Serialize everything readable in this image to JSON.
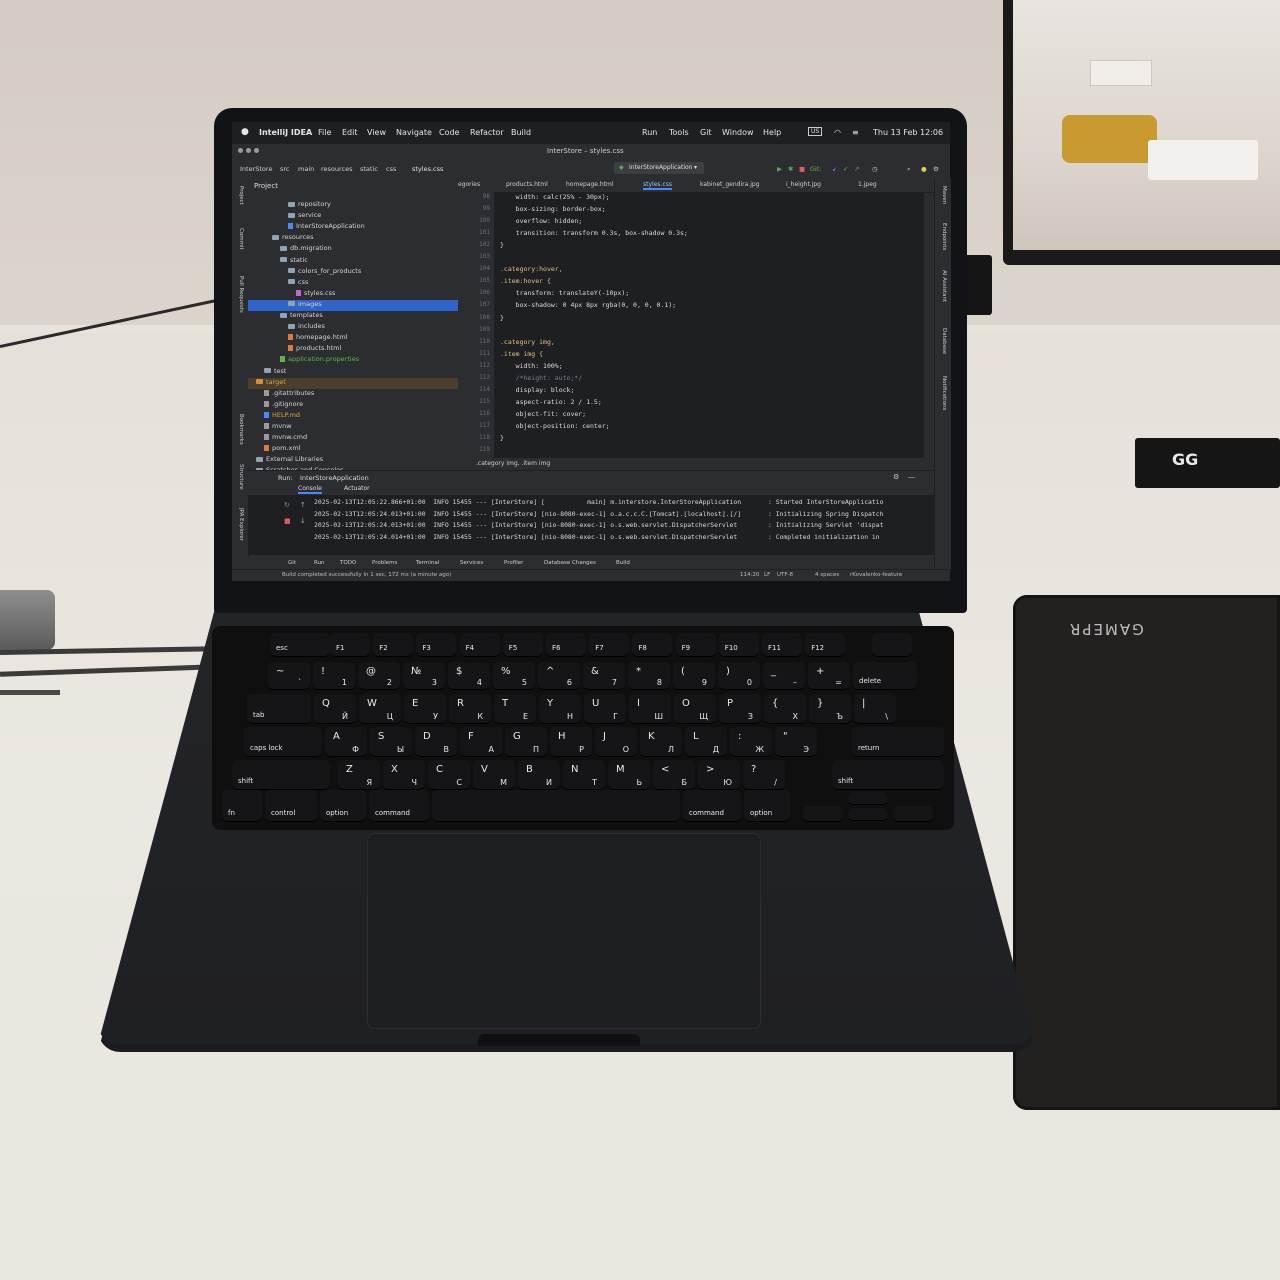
{
  "menubar": {
    "app": "IntelliJ IDEA",
    "items": [
      "File",
      "Edit",
      "View",
      "Navigate",
      "Code",
      "Refactor",
      "Build",
      "Run",
      "Tools",
      "Git",
      "Window",
      "Help"
    ],
    "input_source": "US",
    "clock": "Thu 13 Feb  12:06"
  },
  "window": {
    "title": "InterStore – styles.css"
  },
  "breadcrumbs": [
    "InterStore",
    "src",
    "main",
    "resources",
    "static",
    "css",
    "styles.css"
  ],
  "run_config": "InterStoreApplication",
  "git_label": "Git:",
  "project": {
    "header": "Project",
    "tree": [
      {
        "label": "repository",
        "depth": 4,
        "type": "folder"
      },
      {
        "label": "service",
        "depth": 4,
        "type": "folder"
      },
      {
        "label": "InterStoreApplication",
        "depth": 4,
        "type": "class"
      },
      {
        "label": "resources",
        "depth": 2,
        "type": "folder"
      },
      {
        "label": "db.migration",
        "depth": 3,
        "type": "folder"
      },
      {
        "label": "static",
        "depth": 3,
        "type": "folder"
      },
      {
        "label": "colors_for_products",
        "depth": 4,
        "type": "folder"
      },
      {
        "label": "css",
        "depth": 4,
        "type": "folder"
      },
      {
        "label": "styles.css",
        "depth": 5,
        "type": "css"
      },
      {
        "label": "images",
        "depth": 4,
        "type": "folder",
        "selected": true
      },
      {
        "label": "templates",
        "depth": 3,
        "type": "folder"
      },
      {
        "label": "includes",
        "depth": 4,
        "type": "folder"
      },
      {
        "label": "homepage.html",
        "depth": 4,
        "type": "html"
      },
      {
        "label": "products.html",
        "depth": 4,
        "type": "html"
      },
      {
        "label": "application.properties",
        "depth": 3,
        "type": "props"
      },
      {
        "label": "test",
        "depth": 1,
        "type": "folder"
      },
      {
        "label": "target",
        "depth": 0,
        "type": "folder-orange",
        "highlighted": true
      },
      {
        "label": ".gitattributes",
        "depth": 1,
        "type": "file"
      },
      {
        "label": ".gitignore",
        "depth": 1,
        "type": "file"
      },
      {
        "label": "HELP.md",
        "depth": 1,
        "type": "md"
      },
      {
        "label": "mvnw",
        "depth": 1,
        "type": "file"
      },
      {
        "label": "mvnw.cmd",
        "depth": 1,
        "type": "file"
      },
      {
        "label": "pom.xml",
        "depth": 1,
        "type": "xml"
      },
      {
        "label": "External Libraries",
        "depth": 0,
        "type": "folder"
      },
      {
        "label": "Scratches and Consoles",
        "depth": 0,
        "type": "folder"
      }
    ]
  },
  "left_tools": [
    "Project",
    "Commit",
    "Pull Requests",
    "Bookmarks",
    "Structure",
    "JPA Explorer"
  ],
  "right_tools": [
    "Maven",
    "Endpoints",
    "AI Assistant",
    "Database",
    "Notifications"
  ],
  "tabs": [
    {
      "label": "egories",
      "active": false
    },
    {
      "label": "products.html",
      "active": false
    },
    {
      "label": "homepage.html",
      "active": false
    },
    {
      "label": "styles.css",
      "active": true
    },
    {
      "label": "kabinet_gendira.jpg",
      "active": false
    },
    {
      "label": "i_height.jpg",
      "active": false
    },
    {
      "label": "1.jpeg",
      "active": false
    }
  ],
  "editor": {
    "lines": [
      {
        "n": "98",
        "text": "    width: calc(25% - 30px);"
      },
      {
        "n": "99",
        "text": "    box-sizing: border-box;"
      },
      {
        "n": "100",
        "text": "    overflow: hidden;"
      },
      {
        "n": "101",
        "text": "    transition: transform 0.3s, box-shadow 0.3s;"
      },
      {
        "n": "102",
        "text": "}"
      },
      {
        "n": "103",
        "text": ""
      },
      {
        "n": "104",
        "text": ".category:hover,"
      },
      {
        "n": "105",
        "text": ".item:hover {"
      },
      {
        "n": "106",
        "text": "    transform: translateY(-10px);"
      },
      {
        "n": "107",
        "text": "    box-shadow: 0 4px 8px rgba(0, 0, 0, 0.1);"
      },
      {
        "n": "108",
        "text": "}"
      },
      {
        "n": "109",
        "text": ""
      },
      {
        "n": "110",
        "text": ".category img,"
      },
      {
        "n": "111",
        "text": ".item img {"
      },
      {
        "n": "112",
        "text": "    width: 100%;"
      },
      {
        "n": "113",
        "text": "    /*height: auto;*/"
      },
      {
        "n": "114",
        "text": "    display: block;"
      },
      {
        "n": "115",
        "text": "    aspect-ratio: 2 / 1.5;"
      },
      {
        "n": "116",
        "text": "    object-fit: cover;"
      },
      {
        "n": "117",
        "text": "    object-position: center;"
      },
      {
        "n": "118",
        "text": "}"
      },
      {
        "n": "119",
        "text": ""
      }
    ],
    "breadcrumb": ".category img, .item img"
  },
  "run": {
    "label": "Run:",
    "config": "InterStoreApplication",
    "tabs": [
      "Console",
      "Actuator"
    ],
    "logs": [
      "2025-02-13T12:05:22.866+01:00  INFO 15455 --- [InterStore] [           main] m.interstore.InterStoreApplication       : Started InterStoreApplicatio",
      "2025-02-13T12:05:24.013+01:00  INFO 15455 --- [InterStore] [nio-8080-exec-1] o.a.c.c.C.[Tomcat].[localhost].[/]       : Initializing Spring Dispatch",
      "2025-02-13T12:05:24.013+01:00  INFO 15455 --- [InterStore] [nio-8080-exec-1] o.s.web.servlet.DispatcherServlet        : Initializing Servlet 'dispat",
      "2025-02-13T12:05:24.014+01:00  INFO 15455 --- [InterStore] [nio-8080-exec-1] o.s.web.servlet.DispatcherServlet        : Completed initialization in"
    ]
  },
  "tool_tabs": [
    "Git",
    "Run",
    "TODO",
    "Problems",
    "Terminal",
    "Services",
    "Profiler",
    "Database Changes",
    "Build"
  ],
  "status": {
    "message": "Build completed successfully in 1 sec, 172 ms (a minute ago)",
    "position": "114:20",
    "line_sep": "LF",
    "encoding": "UTF-8",
    "indent": "4 spaces",
    "branch": "rKovalenko-feature"
  },
  "stand_label": "GG",
  "mousepad_brand": "GAMEPR",
  "keyboard": {
    "fn_row": [
      "esc",
      "F1",
      "F2",
      "F3",
      "F4",
      "F5",
      "F6",
      "F7",
      "F8",
      "F9",
      "F10",
      "F11",
      "F12"
    ],
    "num_row": [
      [
        "~",
        "`"
      ],
      [
        "!",
        "1"
      ],
      [
        "@",
        "2"
      ],
      [
        "№",
        "3"
      ],
      [
        "$",
        "4"
      ],
      [
        "%",
        "5"
      ],
      [
        "^",
        "6"
      ],
      [
        "&",
        "7"
      ],
      [
        "*",
        "8"
      ],
      [
        "(",
        "9"
      ],
      [
        ")",
        "0"
      ],
      [
        "_",
        "–"
      ],
      [
        "+",
        "="
      ],
      [
        "delete",
        ""
      ]
    ],
    "top_row": [
      [
        "tab",
        ""
      ],
      [
        "Q",
        "Й"
      ],
      [
        "W",
        "Ц"
      ],
      [
        "E",
        "У"
      ],
      [
        "R",
        "К"
      ],
      [
        "T",
        "Е"
      ],
      [
        "Y",
        "Н"
      ],
      [
        "U",
        "Г"
      ],
      [
        "I",
        "Ш"
      ],
      [
        "O",
        "Щ"
      ],
      [
        "P",
        "З"
      ],
      [
        "{",
        "Х"
      ],
      [
        "}",
        "Ъ"
      ],
      [
        "|",
        "\\"
      ]
    ],
    "home_row": [
      [
        "caps lock",
        ""
      ],
      [
        "A",
        "Ф"
      ],
      [
        "S",
        "Ы"
      ],
      [
        "D",
        "В"
      ],
      [
        "F",
        "А"
      ],
      [
        "G",
        "П"
      ],
      [
        "H",
        "Р"
      ],
      [
        "J",
        "О"
      ],
      [
        "K",
        "Л"
      ],
      [
        "L",
        "Д"
      ],
      [
        ":",
        "Ж"
      ],
      [
        "\"",
        "Э"
      ],
      [
        "return",
        ""
      ]
    ],
    "bottom_row": [
      [
        "shift",
        ""
      ],
      [
        "Z",
        "Я"
      ],
      [
        "X",
        "Ч"
      ],
      [
        "C",
        "С"
      ],
      [
        "V",
        "М"
      ],
      [
        "B",
        "И"
      ],
      [
        "N",
        "Т"
      ],
      [
        "M",
        "Ь"
      ],
      [
        "<",
        "Б"
      ],
      [
        ">",
        "Ю"
      ],
      [
        "?",
        "/"
      ],
      [
        "shift",
        ""
      ]
    ],
    "mod_row": [
      "fn",
      "control",
      "option",
      "command",
      "",
      "command",
      "option"
    ]
  }
}
